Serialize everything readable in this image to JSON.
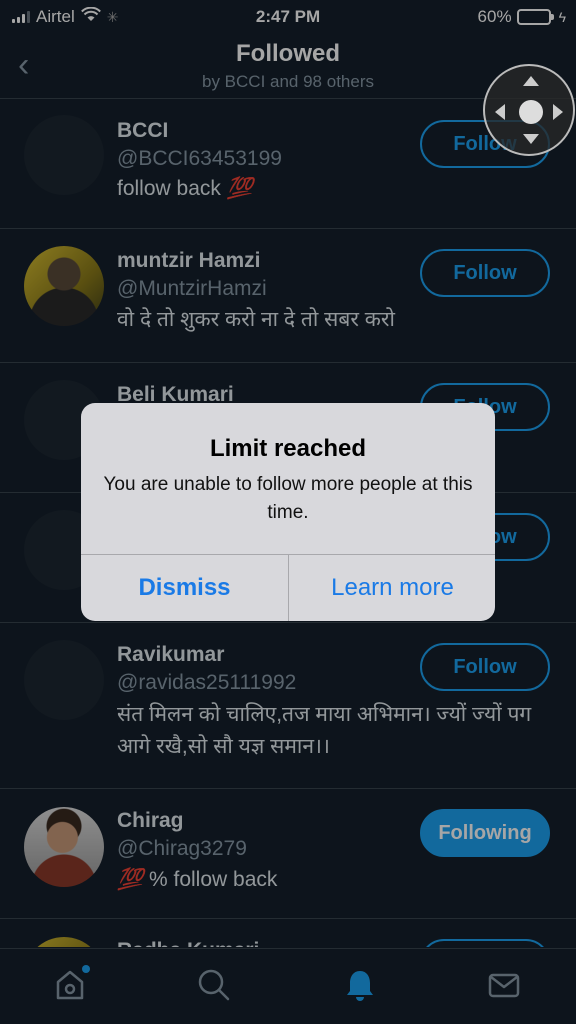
{
  "status_bar": {
    "carrier": "Airtel",
    "time": "2:47 PM",
    "battery": "60%",
    "battery_level": 0.6
  },
  "header": {
    "title": "Followed",
    "subtitle": "by BCCI and 98 others"
  },
  "users": [
    {
      "name": "BCCI",
      "handle": "@BCCI63453199",
      "bio_text": "follow back",
      "bio_emoji": "💯",
      "button": "Follow"
    },
    {
      "name": "muntzir Hamzi",
      "handle": "@MuntzirHamzi",
      "bio": "वो दे तो शुकर करो ना दे तो सबर करो",
      "button": "Follow"
    },
    {
      "name": "Beli Kumari",
      "button": "Follow"
    },
    {
      "button": "Follow"
    },
    {
      "name": "Ravikumar",
      "handle": "@ravidas25111992",
      "bio": "संत मिलन को चालिए,तज माया अभिमान। ज्यों ज्यों पग आगे रखै,सो सौ यज्ञ समान।।",
      "button": "Follow"
    },
    {
      "name": "Chirag",
      "handle": "@Chirag3279",
      "bio_emoji": "💯",
      "bio_text": "% follow back",
      "button": "Following"
    },
    {
      "name": "Radha Kumari"
    }
  ],
  "alert": {
    "title": "Limit reached",
    "message": "You are unable to follow more people at this time.",
    "dismiss": "Dismiss",
    "learn_more": "Learn more"
  },
  "colors": {
    "background": "#15202b",
    "accent": "#1da1f2",
    "alert_bg": "#d8d8dc",
    "alert_button": "#1a7ae6",
    "battery": "#f5c518"
  }
}
